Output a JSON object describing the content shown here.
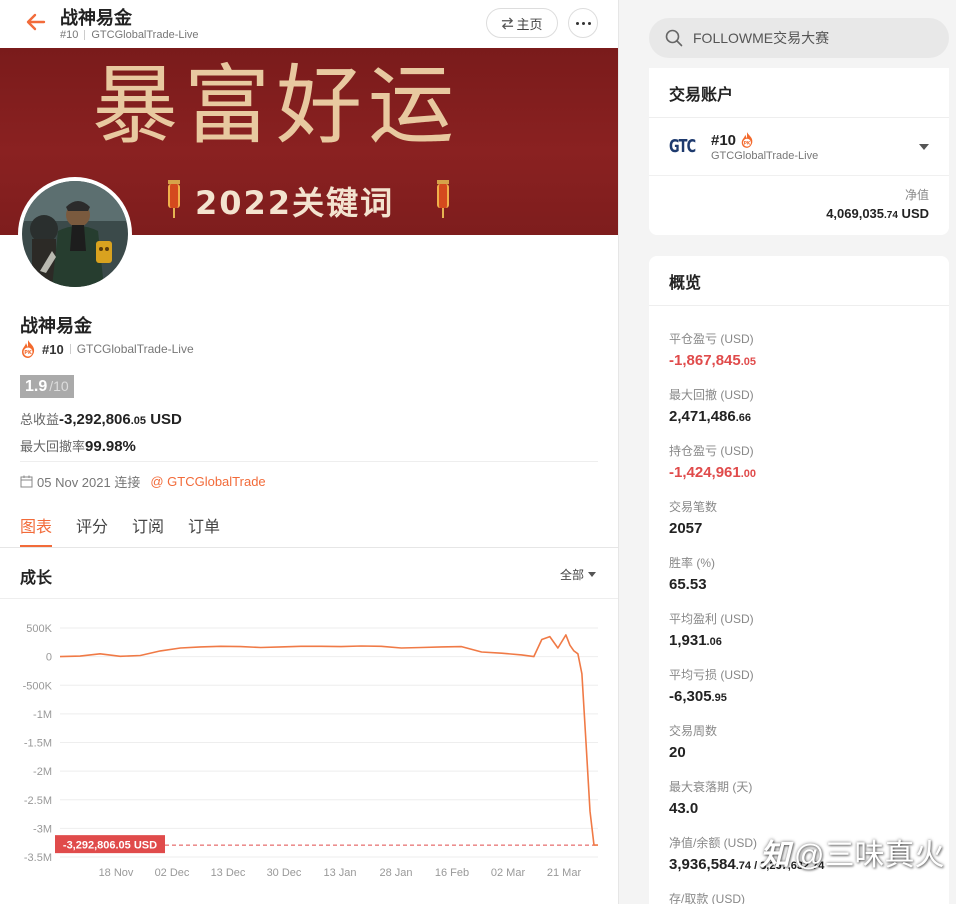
{
  "header": {
    "title": "战神易金",
    "rank": "#10",
    "account": "GTCGlobalTrade-Live",
    "home_label": "主页"
  },
  "banner": {
    "main_text": "暴富好运",
    "year_text": "2022关键词"
  },
  "profile": {
    "name": "战神易金",
    "rank": "#10",
    "account": "GTCGlobalTrade-Live",
    "score": "1.9",
    "score_max": "/10",
    "total_label": "总收益",
    "total_int": "-3,292,806",
    "total_dec": ".05",
    "total_unit": " USD",
    "drawdown_label": "最大回撤率",
    "drawdown_value": "99.98%",
    "joined_date": "05 Nov 2021 连接",
    "broker_link": "@ GTCGlobalTrade"
  },
  "tabs": [
    "图表",
    "评分",
    "订阅",
    "订单"
  ],
  "growth": {
    "title": "成长",
    "range": "全部"
  },
  "chart_data": {
    "type": "line",
    "y_ticks": [
      "500K",
      "0",
      "-500K",
      "-1M",
      "-1.5M",
      "-2M",
      "-2.5M",
      "-3M",
      "-3.5M"
    ],
    "x_ticks": [
      "18 Nov",
      "02 Dec",
      "13 Dec",
      "30 Dec",
      "13 Jan",
      "28 Jan",
      "16 Feb",
      "02 Mar",
      "21 Mar"
    ],
    "ylim": [
      -3500000,
      500000
    ],
    "x": [
      0,
      5,
      10,
      15,
      20,
      25,
      30,
      35,
      40,
      45,
      50,
      55,
      60,
      65,
      70,
      75,
      80,
      85,
      90,
      95,
      100,
      105,
      110,
      115,
      118,
      120,
      122,
      124,
      126,
      127,
      128,
      129,
      130,
      131,
      132,
      133,
      134
    ],
    "values": [
      0,
      10000,
      50000,
      5000,
      20000,
      100000,
      150000,
      170000,
      180000,
      175000,
      160000,
      170000,
      180000,
      180000,
      175000,
      185000,
      180000,
      150000,
      160000,
      170000,
      175000,
      80000,
      60000,
      30000,
      0,
      300000,
      350000,
      150000,
      380000,
      200000,
      100000,
      50000,
      -300000,
      -1500000,
      -2700000,
      -3292806.05,
      -3292806.05
    ],
    "current_label": "-3,292,806.05 USD",
    "current_value": -3292806.05,
    "line_color": "#f07a46"
  },
  "sidebar": {
    "search_placeholder": "FOLLOWME交易大赛",
    "account_card": {
      "title": "交易账户",
      "rank": "#10",
      "account": "GTCGlobalTrade-Live",
      "nv_label": "净值",
      "nv_int": "4,069,035",
      "nv_dec": ".74",
      "nv_unit": " USD"
    },
    "overview": {
      "title": "概览",
      "items": [
        {
          "label": "平仓盈亏 (USD)",
          "int": "-1,867,845",
          "dec": ".05",
          "neg": true
        },
        {
          "label": "最大回撤 (USD)",
          "int": "2,471,486",
          "dec": ".66",
          "neg": false
        },
        {
          "label": "持仓盈亏 (USD)",
          "int": "-1,424,961",
          "dec": ".00",
          "neg": true
        },
        {
          "label": "交易笔数",
          "int": "2057",
          "dec": "",
          "neg": false
        },
        {
          "label": "胜率 (%)",
          "int": "65.53",
          "dec": "",
          "neg": false
        },
        {
          "label": "平均盈利 (USD)",
          "int": "1,931",
          "dec": ".06",
          "neg": false
        },
        {
          "label": "平均亏损 (USD)",
          "int": "-6,305",
          "dec": ".95",
          "neg": false
        },
        {
          "label": "交易周数",
          "int": "20",
          "dec": "",
          "neg": false
        },
        {
          "label": "最大衰落期 (天)",
          "int": "43.0",
          "dec": "",
          "neg": false
        },
        {
          "label": "净值/余额 (USD)",
          "int": "3,936,584",
          "dec": ".74 / 3,267,632.74",
          "neg": false
        },
        {
          "label": "存/取款 (USD)",
          "int": "",
          "dec": "",
          "neg": false
        }
      ]
    }
  },
  "watermark": {
    "logo": "知",
    "text": "@三味真火"
  },
  "colors": {
    "accent": "#f26b3a",
    "negative": "#e04b4b",
    "banner": "#7e1d1d"
  }
}
